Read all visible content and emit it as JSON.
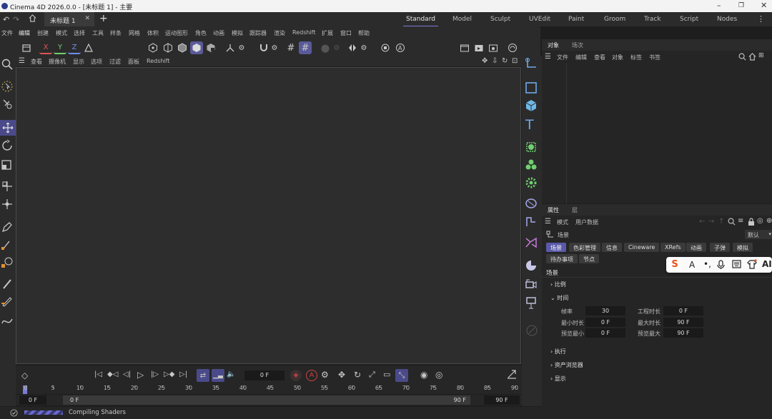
{
  "titlebar": {
    "title": "Cinema 4D 2026.0.0 - [未标题 1] - 主要"
  },
  "tabs": {
    "document": "未标题 1",
    "add": "+",
    "layouts": [
      "Standard",
      "Model",
      "Sculpt",
      "UVEdit",
      "Paint",
      "Groom",
      "Track",
      "Script",
      "Nodes"
    ],
    "active_layout": "Standard"
  },
  "menu": [
    "文件",
    "编辑",
    "创建",
    "模式",
    "选择",
    "工具",
    "样条",
    "网格",
    "体积",
    "运动图形",
    "角色",
    "动画",
    "模拟",
    "跟踪器",
    "渲染",
    "Redshift",
    "扩展",
    "窗口",
    "帮助"
  ],
  "axes": {
    "x": "X",
    "y": "Y",
    "z": "Z"
  },
  "viewport": {
    "menu": [
      "查看",
      "摄像机",
      "显示",
      "选项",
      "过滤",
      "面板",
      "Redshift"
    ]
  },
  "object_manager": {
    "tabs": [
      "对象",
      "场次"
    ],
    "menu": [
      "文件",
      "编辑",
      "查看",
      "对象",
      "标签",
      "书签"
    ]
  },
  "attributes": {
    "tabs": [
      "属性",
      "层"
    ],
    "menu": [
      "模式",
      "用户数据"
    ],
    "context": "场景",
    "preset": "默认",
    "chips_row1": [
      "场景",
      "色彩管理",
      "信息",
      "Cineware",
      "XRefs",
      "动画",
      "子弹",
      "模拟"
    ],
    "chips_row2": [
      "待办事项",
      "节点"
    ],
    "heading": "场景",
    "sections": {
      "scale": "比例",
      "time": "时间",
      "execute": "执行",
      "asset": "资产浏览器",
      "display": "显示"
    },
    "fields": {
      "fps_label": "帧率",
      "fps": "30",
      "project_len_label": "工程时长",
      "project_len": "0 F",
      "min_len_label": "最小时长",
      "min_len": "0 F",
      "max_len_label": "最大时长",
      "max_len": "90 F",
      "preview_min_label": "预览最小",
      "preview_min": "0 F",
      "preview_max_label": "预览最大",
      "preview_max": "90 F"
    }
  },
  "timeline": {
    "current_frame": "0 F",
    "ruler_ticks": [
      "0",
      "5",
      "10",
      "15",
      "20",
      "25",
      "30",
      "35",
      "40",
      "45",
      "50",
      "55",
      "60",
      "65",
      "70",
      "75",
      "80",
      "85",
      "90"
    ],
    "range_start": "0 F",
    "range_min": "0 F",
    "range_max": "90 F",
    "range_end": "90 F"
  },
  "status": {
    "text": "Compiling Shaders"
  },
  "ime_toolbar": {
    "letter": "A",
    "ai": "AI"
  },
  "colors": {
    "accent": "#7b7bd6",
    "active_chip": "#5a5aa8",
    "bg": "#1e1e1e"
  }
}
